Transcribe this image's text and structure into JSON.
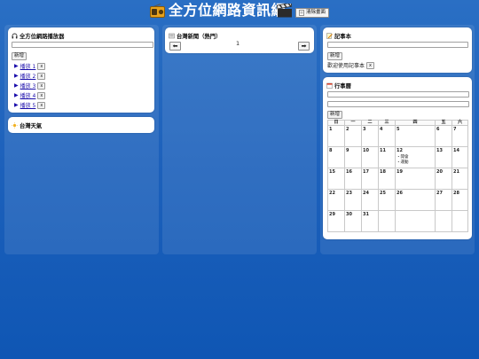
{
  "header": {
    "title": "全方位網路資訊網",
    "clear_button": "清除畫面"
  },
  "player": {
    "title": "全方位網路播放器",
    "add_button": "新增",
    "items": [
      {
        "label": "播放 1",
        "remove": "x"
      },
      {
        "label": "播放 2",
        "remove": "x"
      },
      {
        "label": "播放 3",
        "remove": "x"
      },
      {
        "label": "播放 4",
        "remove": "x"
      },
      {
        "label": "播放 5",
        "remove": "x"
      }
    ]
  },
  "weather": {
    "title": "台灣天氣"
  },
  "news": {
    "title": "台灣新聞（熱門）",
    "page": "1",
    "prev_icon": "arrow-left-icon",
    "next_icon": "arrow-right-icon"
  },
  "notepad": {
    "title": "記事本",
    "add_button": "新增",
    "note": "歡迎使用記事本",
    "remove": "x"
  },
  "calendar": {
    "title": "行事曆",
    "add_button": "新增",
    "weekdays": [
      "日",
      "一",
      "二",
      "三",
      "四",
      "五",
      "六"
    ],
    "weeks": [
      [
        {
          "d": "1"
        },
        {
          "d": "2"
        },
        {
          "d": "3"
        },
        {
          "d": "4"
        },
        {
          "d": "5"
        },
        {
          "d": "6"
        },
        {
          "d": "7"
        }
      ],
      [
        {
          "d": "8"
        },
        {
          "d": "9"
        },
        {
          "d": "10"
        },
        {
          "d": "11"
        },
        {
          "d": "12",
          "events": [
            "・開會",
            "・運動"
          ]
        },
        {
          "d": "13"
        },
        {
          "d": "14"
        }
      ],
      [
        {
          "d": "15"
        },
        {
          "d": "16"
        },
        {
          "d": "17"
        },
        {
          "d": "18"
        },
        {
          "d": "19"
        },
        {
          "d": "20"
        },
        {
          "d": "21"
        }
      ],
      [
        {
          "d": "22"
        },
        {
          "d": "23"
        },
        {
          "d": "24"
        },
        {
          "d": "25"
        },
        {
          "d": "26"
        },
        {
          "d": "27"
        },
        {
          "d": "28"
        }
      ],
      [
        {
          "d": "29"
        },
        {
          "d": "30"
        },
        {
          "d": "31"
        },
        {
          "d": ""
        },
        {
          "d": ""
        },
        {
          "d": ""
        },
        {
          "d": ""
        }
      ]
    ]
  },
  "colors": {
    "background_top": "#2a6fc4",
    "background_bottom": "#0f56b4",
    "link": "#1a0dab"
  }
}
